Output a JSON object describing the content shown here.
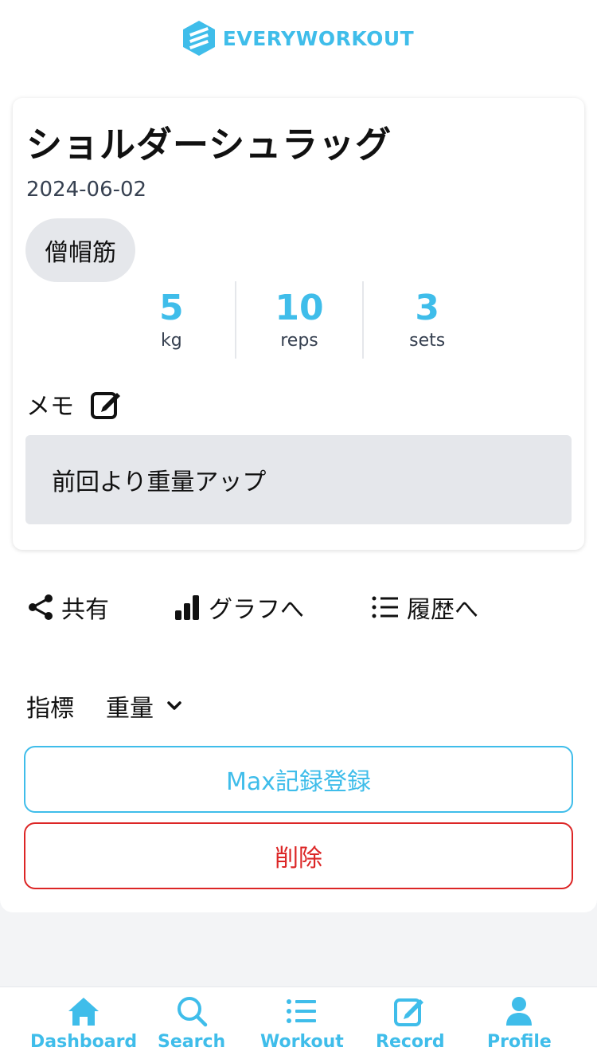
{
  "brand": {
    "name": "EVERYWORKOUT",
    "color": "#3fbdea"
  },
  "workout": {
    "title": "ショルダーシュラッグ",
    "date": "2024-06-02",
    "muscle_tag": "僧帽筋",
    "stats": [
      {
        "value": "5",
        "unit": "kg"
      },
      {
        "value": "10",
        "unit": "reps"
      },
      {
        "value": "3",
        "unit": "sets"
      }
    ],
    "memo_label": "メモ",
    "memo_text": "前回より重量アップ"
  },
  "actions": {
    "share": "共有",
    "graph": "グラフへ",
    "history": "履歴へ"
  },
  "metric": {
    "label": "指標",
    "selected": "重量"
  },
  "buttons": {
    "max_record": "Max記録登録",
    "delete": "削除"
  },
  "colors": {
    "accent": "#3fbdea",
    "danger": "#dc2626",
    "badge_bg": "#e5e7eb"
  },
  "tabbar": [
    {
      "label": "Dashboard",
      "icon": "home-icon"
    },
    {
      "label": "Search",
      "icon": "search-icon"
    },
    {
      "label": "Workout",
      "icon": "list-icon"
    },
    {
      "label": "Record",
      "icon": "edit-icon"
    },
    {
      "label": "Profile",
      "icon": "user-icon"
    }
  ]
}
